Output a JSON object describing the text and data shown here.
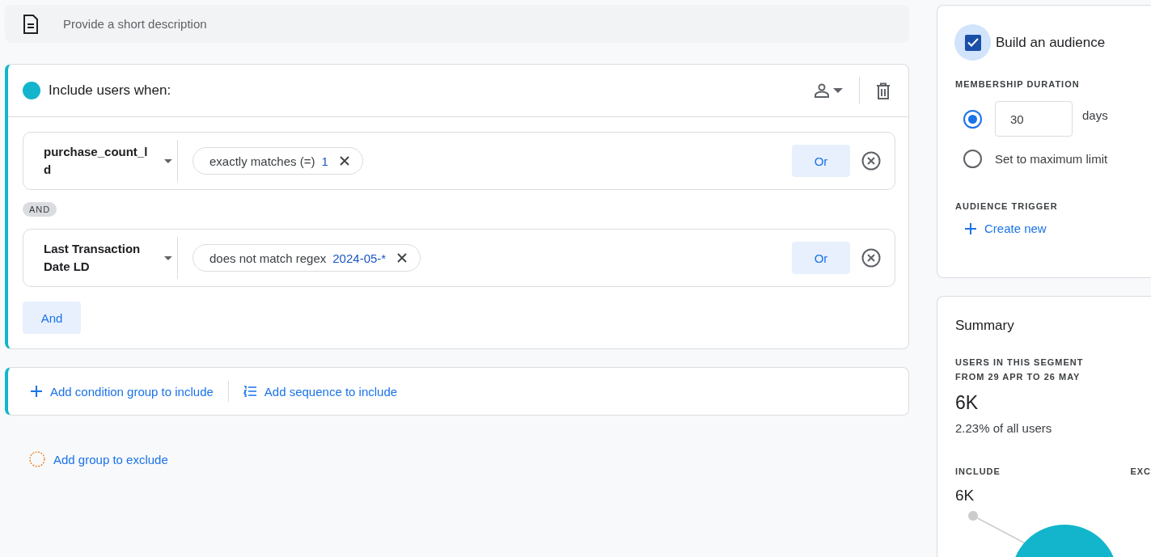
{
  "description": {
    "placeholder": "Provide a short description"
  },
  "include_group": {
    "title": "Include users when:",
    "conditions": [
      {
        "dimension": "purchase_count_ld",
        "operator": "exactly matches (=)",
        "value": "1",
        "or_button": "Or"
      },
      {
        "dimension": "Last Transaction Date LD",
        "operator": "does not match regex",
        "value": "2024-05-*",
        "or_button": "Or"
      }
    ],
    "connector": "AND",
    "and_button": "And"
  },
  "add_actions": [
    {
      "kind": "condition_group",
      "label": "Add condition group to include"
    },
    {
      "kind": "sequence",
      "label": "Add sequence to include"
    }
  ],
  "exclude": {
    "label": "Add group to exclude"
  },
  "audience": {
    "label": "Build an audience",
    "checked": true,
    "duration_heading": "MEMBERSHIP DURATION",
    "options": [
      {
        "kind": "days",
        "value": "30",
        "unit": "days",
        "selected": true
      },
      {
        "kind": "maximum",
        "label": "Set to maximum limit",
        "selected": false
      }
    ],
    "trigger_heading": "AUDIENCE TRIGGER",
    "create_new": "Create new"
  },
  "summary": {
    "title": "Summary",
    "users_heading": "USERS IN THIS SEGMENT",
    "range_heading": "FROM 29 APR TO 26 MAY",
    "count": "6K",
    "share": "2.23% of all users",
    "include_label": "INCLUDE",
    "exclude_label": "EXC",
    "include_count": "6K"
  }
}
